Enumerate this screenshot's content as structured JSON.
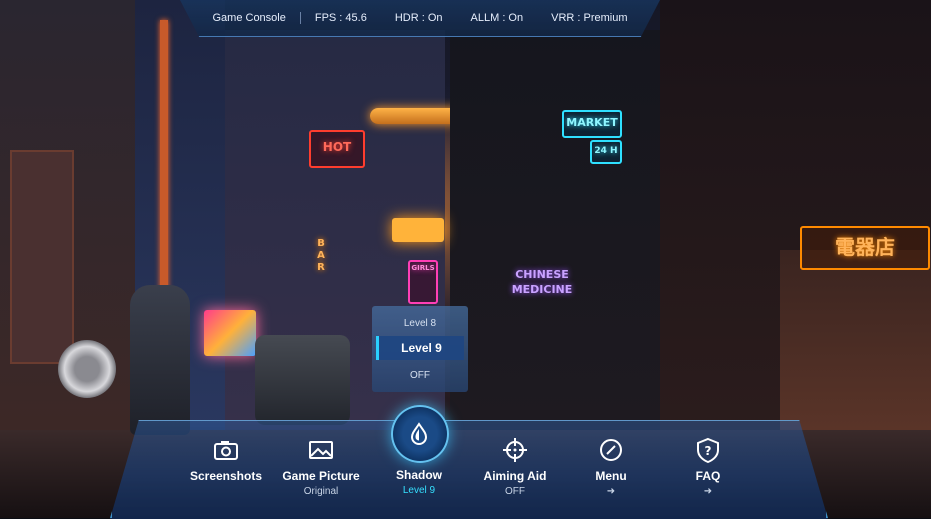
{
  "status_bar": {
    "title": "Game Console",
    "fps": "FPS : 45.6",
    "hdr": "HDR : On",
    "allm": "ALLM : On",
    "vrr": "VRR : Premium"
  },
  "shadow_popup": {
    "options": [
      "Level 8",
      "Level 9",
      "OFF"
    ],
    "selected": "Level 9"
  },
  "dock": {
    "items": [
      {
        "label": "Screenshots",
        "sub": "",
        "icon": "camera-icon"
      },
      {
        "label": "Game Picture",
        "sub": "Original",
        "icon": "picture-icon"
      },
      {
        "label": "Shadow",
        "sub": "Level 9",
        "icon": "shadow-drop-icon"
      },
      {
        "label": "Aiming Aid",
        "sub": "OFF",
        "icon": "crosshair-icon"
      },
      {
        "label": "Menu",
        "sub": "",
        "icon": "menu-compass-icon"
      },
      {
        "label": "FAQ",
        "sub": "",
        "icon": "question-shield-icon"
      }
    ],
    "accent": "#35e0ff"
  },
  "scene_signs": {
    "market": "MARKET",
    "market_num": "24 H",
    "chinese": "CHINESE",
    "medicine": "MEDICINE",
    "bar": "BAR",
    "girls": "GIRLS",
    "hot": "HOT",
    "denki": "電器店"
  }
}
